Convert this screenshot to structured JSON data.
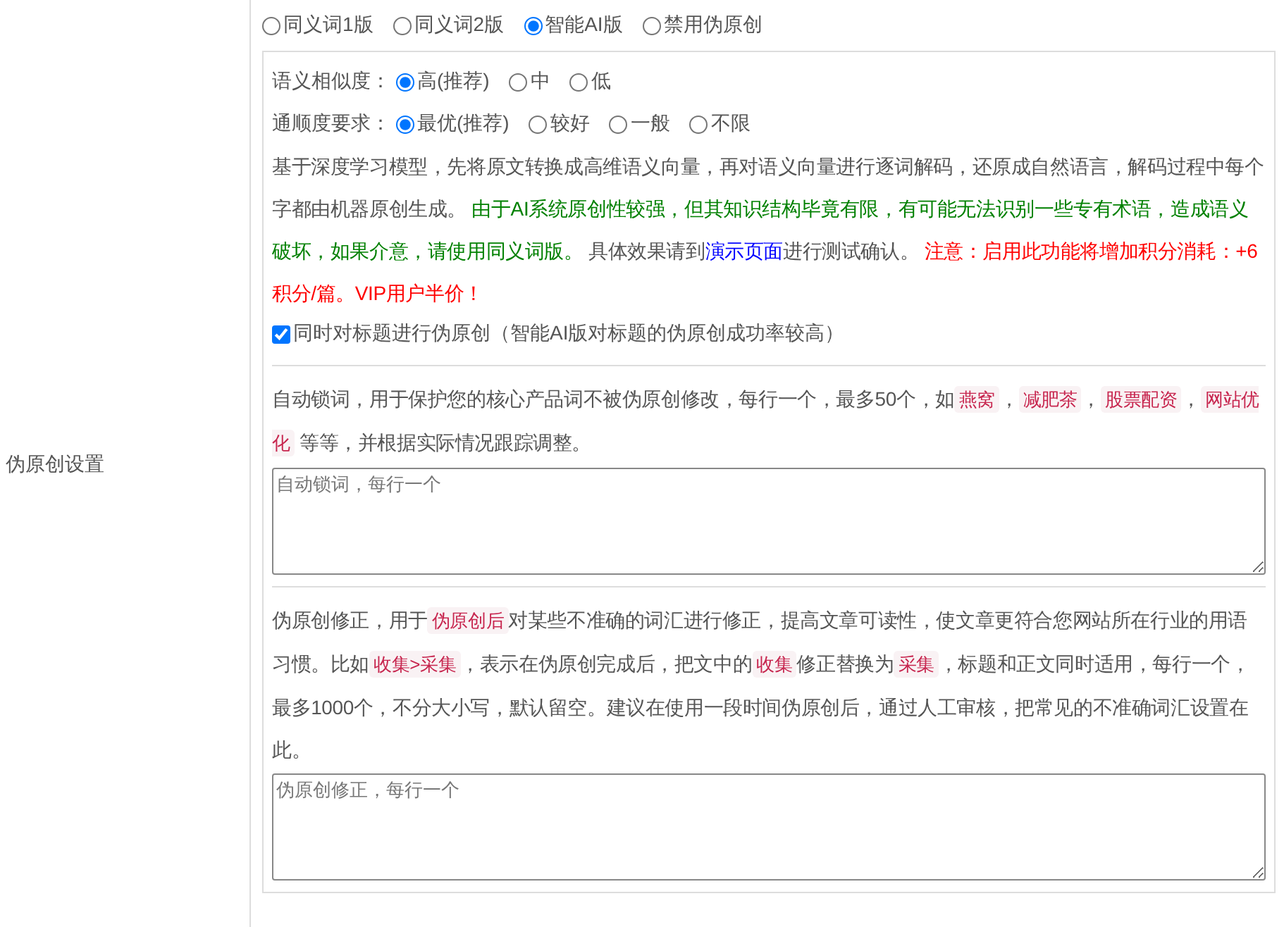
{
  "sidebar_label": "伪原创设置",
  "modes": [
    {
      "label": "同义词1版",
      "selected": false
    },
    {
      "label": "同义词2版",
      "selected": false
    },
    {
      "label": "智能AI版",
      "selected": true
    },
    {
      "label": "禁用伪原创",
      "selected": false
    }
  ],
  "ai_settings": {
    "similarity": {
      "label": "语义相似度：",
      "options": [
        {
          "label": "高(推荐)",
          "selected": true
        },
        {
          "label": "中",
          "selected": false
        },
        {
          "label": "低",
          "selected": false
        }
      ]
    },
    "fluency": {
      "label": "通顺度要求：",
      "options": [
        {
          "label": "最优(推荐)",
          "selected": true
        },
        {
          "label": "较好",
          "selected": false
        },
        {
          "label": "一般",
          "selected": false
        },
        {
          "label": "不限",
          "selected": false
        }
      ]
    },
    "description": [
      {
        "kind": "plain",
        "text": "基于深度学习模型，先将原文转换成高维语义向量，再对语义向量进行逐词解码，还原成自然语言，解码过程中每个字都由机器原创生成。 "
      },
      {
        "kind": "highlight",
        "text": "由于AI系统原创性较强，但其知识结构毕竟有限，有可能无法识别一些专有术语，造成语义破坏，如果介意，请使用同义词版。"
      },
      {
        "kind": "plain",
        "text": " 具体效果请到"
      },
      {
        "kind": "link",
        "text": "演示页面"
      },
      {
        "kind": "plain",
        "text": "进行测试确认。 "
      },
      {
        "kind": "warning",
        "text": "注意：启用此功能将增加积分消耗：+6积分/篇。VIP用户半价！"
      }
    ],
    "title_option": {
      "label": "同时对标题进行伪原创（智能AI版对标题的伪原创成功率较高）",
      "checked": true
    }
  },
  "lock_words": {
    "description": [
      {
        "kind": "plain",
        "text": "自动锁词，用于保护您的核心产品词不被伪原创修改，每行一个，最多50个，如"
      },
      {
        "kind": "tag",
        "text": "燕窝"
      },
      {
        "kind": "plain",
        "text": "，"
      },
      {
        "kind": "tag",
        "text": "减肥茶"
      },
      {
        "kind": "plain",
        "text": "，"
      },
      {
        "kind": "tag",
        "text": "股票配资"
      },
      {
        "kind": "plain",
        "text": "，"
      },
      {
        "kind": "tag",
        "text": "网站优化"
      },
      {
        "kind": "plain",
        "text": " 等等，并根据实际情况跟踪调整。"
      }
    ],
    "placeholder": "自动锁词，每行一个"
  },
  "corrections": {
    "description": [
      {
        "kind": "plain",
        "text": "伪原创修正，用于"
      },
      {
        "kind": "tag",
        "text": "伪原创后"
      },
      {
        "kind": "plain",
        "text": "对某些不准确的词汇进行修正，提高文章可读性，使文章更符合您网站所在行业的用语习惯。比如"
      },
      {
        "kind": "tag",
        "text": "收集>采集"
      },
      {
        "kind": "plain",
        "text": "，表示在伪原创完成后，把文中的"
      },
      {
        "kind": "tag",
        "text": "收集"
      },
      {
        "kind": "plain",
        "text": "修正替换为"
      },
      {
        "kind": "tag",
        "text": "采集"
      },
      {
        "kind": "plain",
        "text": "，标题和正文同时适用，每行一个，最多1000个，不分大小写，默认留空。建议在使用一段时间伪原创后，通过人工审核，把常见的不准确词汇设置在此。"
      }
    ],
    "placeholder": "伪原创修正，每行一个"
  }
}
